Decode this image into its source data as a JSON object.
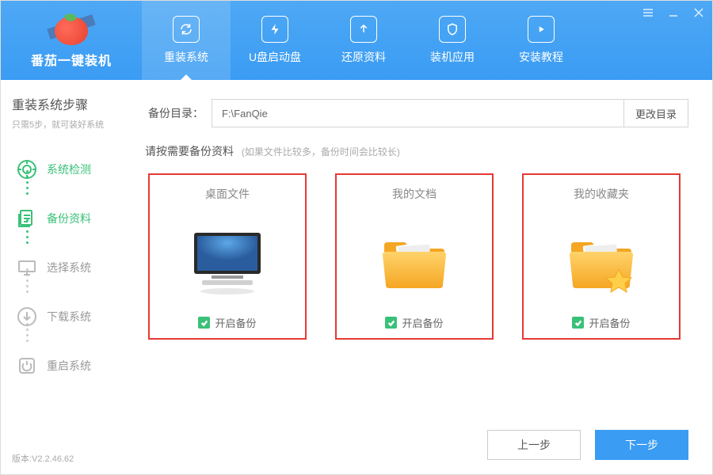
{
  "app": {
    "name": "番茄一键装机"
  },
  "nav": [
    {
      "label": "重装系统"
    },
    {
      "label": "U盘启动盘"
    },
    {
      "label": "还原资料"
    },
    {
      "label": "装机应用"
    },
    {
      "label": "安装教程"
    }
  ],
  "sidebar": {
    "title": "重装系统步骤",
    "subtitle": "只需5步，就可装好系统",
    "steps": [
      {
        "label": "系统检测"
      },
      {
        "label": "备份资料"
      },
      {
        "label": "选择系统"
      },
      {
        "label": "下载系统"
      },
      {
        "label": "重启系统"
      }
    ],
    "version": "版本:V2.2.46.62"
  },
  "main": {
    "dir_label": "备份目录：",
    "dir_value": "F:\\FanQie",
    "dir_btn": "更改目录",
    "hint_main": "请按需要备份资料",
    "hint_sub": "(如果文件比较多，备份时间会比较长)",
    "cards": [
      {
        "title": "桌面文件",
        "check_label": "开启备份"
      },
      {
        "title": "我的文档",
        "check_label": "开启备份"
      },
      {
        "title": "我的收藏夹",
        "check_label": "开启备份"
      }
    ],
    "prev": "上一步",
    "next": "下一步"
  }
}
